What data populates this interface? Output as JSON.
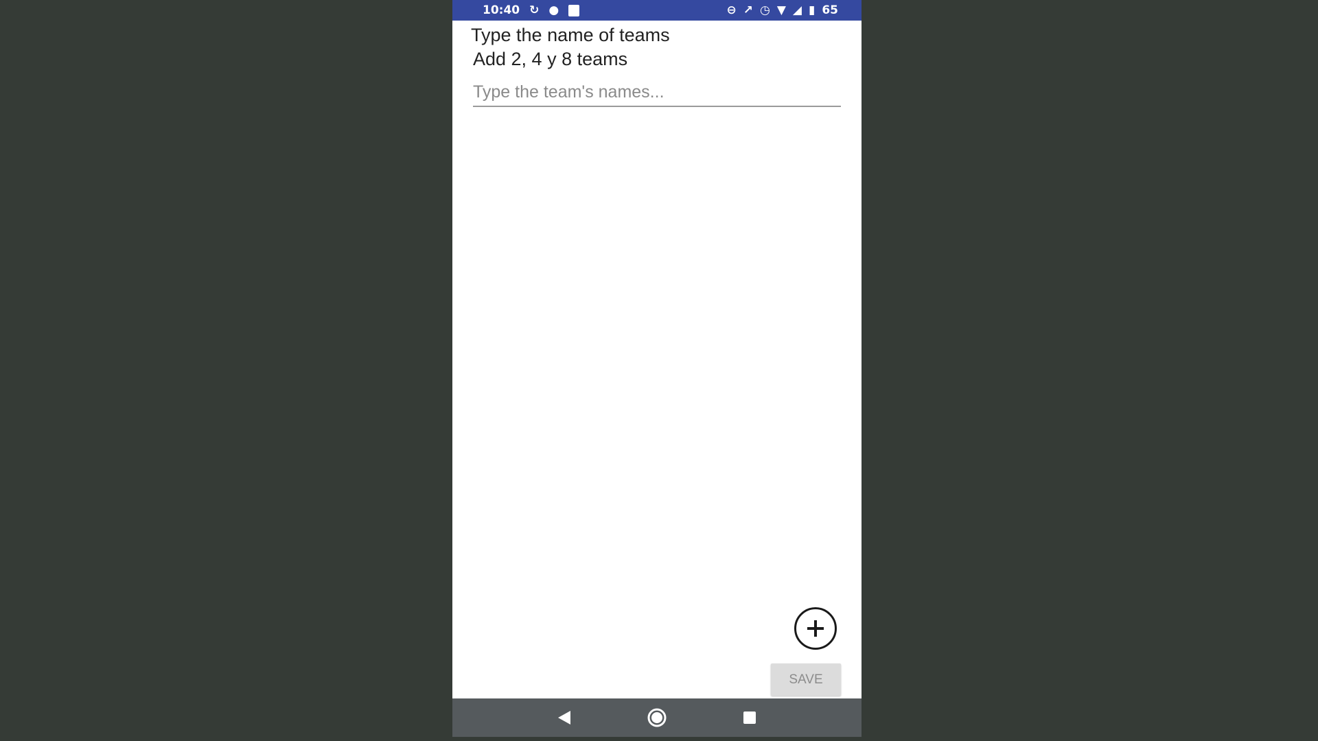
{
  "status_bar": {
    "time": "10:40",
    "battery": "65",
    "left_icons": [
      "sync-icon",
      "notification-icon",
      "image-icon"
    ],
    "right_icons": [
      "do-not-disturb-icon",
      "nfc-icon",
      "alarm-icon",
      "wifi-icon",
      "signal-icon",
      "battery-icon"
    ],
    "background_color": "#3549a0"
  },
  "screen": {
    "title": "Type the name of teams",
    "subtitle": "Add 2, 4 y 8 teams",
    "team_input": {
      "value": "",
      "placeholder": "Type the team's names..."
    },
    "add_button_icon": "plus-circle-icon",
    "save_label": "SAVE"
  },
  "nav_bar": {
    "back_icon": "back-triangle-icon",
    "home_icon": "home-circle-icon",
    "recents_icon": "recents-square-icon",
    "background_color": "#555a5d"
  }
}
